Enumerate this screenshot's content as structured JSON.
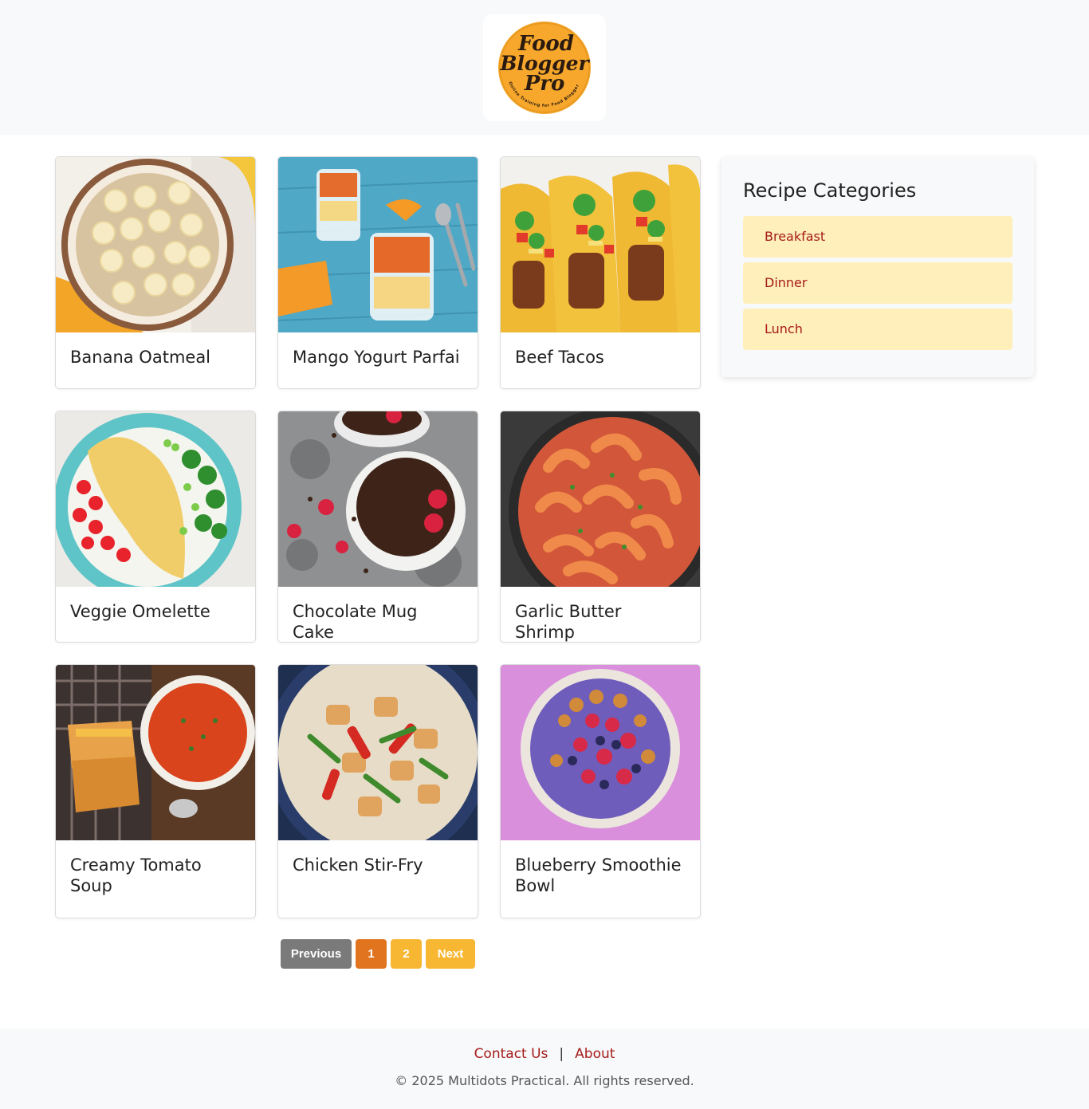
{
  "header": {
    "logo": {
      "text_line1": "Food",
      "text_line2": "Blogger",
      "text_line3": "Pro",
      "tagline": "Online Training for Food Bloggers",
      "color": "#f6a72c"
    }
  },
  "recipes": [
    {
      "title": "Banana Oatmeal",
      "image": "banana-oatmeal-photo"
    },
    {
      "title": "Mango Yogurt Parfai",
      "image": "mango-yogurt-parfait-photo"
    },
    {
      "title": "Beef Tacos",
      "image": "beef-tacos-photo"
    },
    {
      "title": "Veggie Omelette",
      "image": "veggie-omelette-photo"
    },
    {
      "title": "Chocolate Mug Cake",
      "image": "chocolate-mug-cake-photo"
    },
    {
      "title": "Garlic Butter Shrimp",
      "image": "garlic-butter-shrimp-photo"
    },
    {
      "title": "Creamy Tomato Soup",
      "image": "creamy-tomato-soup-photo"
    },
    {
      "title": "Chicken Stir-Fry",
      "image": "chicken-stir-fry-photo"
    },
    {
      "title": "Blueberry Smoothie Bowl",
      "image": "blueberry-smoothie-bowl-photo"
    }
  ],
  "sidebar": {
    "title": "Recipe Categories",
    "categories": [
      "Breakfast",
      "Dinner",
      "Lunch"
    ]
  },
  "pagination": {
    "previous": "Previous",
    "pages": [
      "1",
      "2"
    ],
    "current_page": "1",
    "next": "Next"
  },
  "footer": {
    "contact": "Contact Us",
    "separator": "|",
    "about": "About",
    "copyright": "© 2025 Multidots Practical. All rights reserved."
  },
  "colors": {
    "accent": "#a61b1b",
    "page_active": "#e0741f",
    "page_inactive": "#f7b733",
    "previous_button": "#7a7a7a",
    "category_bg": "#ffefba"
  }
}
